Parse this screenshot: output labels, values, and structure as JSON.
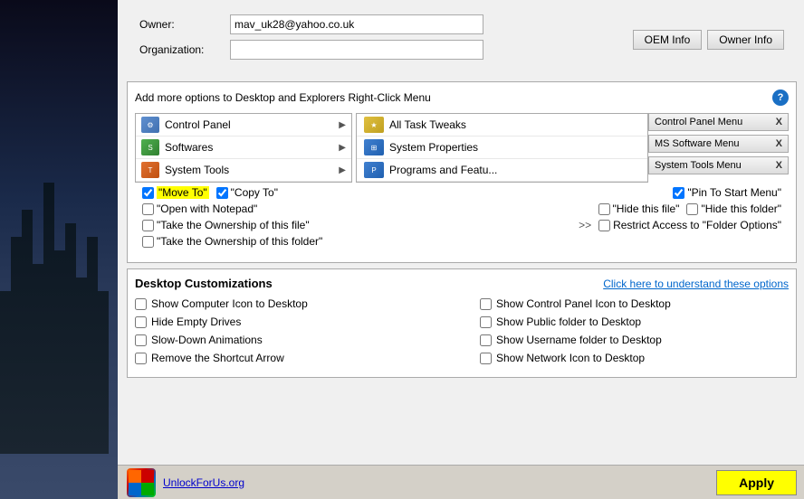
{
  "background": {
    "color": "#1a2a4a"
  },
  "panel": {
    "owner_label": "Owner:",
    "owner_value": "mav_uk28@yahoo.co.uk",
    "org_label": "Organization:",
    "org_value": "",
    "oem_button": "OEM Info",
    "owner_info_button": "Owner Info"
  },
  "rcm": {
    "title": "Add more options to Desktop and Explorers Right-Click Menu",
    "help_icon": "?",
    "tree": [
      {
        "label": "Control Panel",
        "icon": "cp"
      },
      {
        "label": "Softwares",
        "icon": "sw"
      },
      {
        "label": "System Tools",
        "icon": "st"
      }
    ],
    "tweaks": [
      {
        "label": "All Task Tweaks",
        "icon": "yellow"
      },
      {
        "label": "System Properties",
        "icon": "blue"
      },
      {
        "label": "Programs and Featu...",
        "icon": "blue"
      }
    ],
    "remove_buttons": [
      {
        "label": "Control Panel Menu",
        "x": "X"
      },
      {
        "label": "MS Software Menu",
        "x": "X"
      },
      {
        "label": "System Tools Menu",
        "x": "X"
      }
    ]
  },
  "checkboxes": {
    "row1": [
      {
        "label": "\"Move To\"",
        "checked": true,
        "highlight": true
      },
      {
        "label": "\"Copy To\"",
        "checked": true
      },
      {
        "label": "\"Pin To Start Menu\"",
        "checked": true
      }
    ],
    "row2": [
      {
        "label": "\"Open with Notepad\"",
        "checked": false
      },
      {
        "label": "\"Hide this file\"",
        "checked": false
      },
      {
        "label": "\"Hide this folder\"",
        "checked": false
      }
    ],
    "row3": [
      {
        "label": "\"Take the Ownership of this file\"",
        "checked": false
      },
      {
        "arrow": ">>",
        "label": "Restrict Access to \"Folder Options\"",
        "checked": false
      }
    ],
    "row4": [
      {
        "label": "\"Take the Ownership of this folder\"",
        "checked": false
      }
    ]
  },
  "desktop": {
    "title": "Desktop Customizations",
    "understand_link": "Click here to understand these options",
    "left_options": [
      {
        "label": "Show Computer Icon to Desktop",
        "checked": false
      },
      {
        "label": "Hide Empty Drives",
        "checked": false
      },
      {
        "label": "Slow-Down Animations",
        "checked": false
      },
      {
        "label": "Remove the Shortcut Arrow",
        "checked": false
      }
    ],
    "right_options": [
      {
        "label": "Show Control Panel Icon to Desktop",
        "checked": false
      },
      {
        "label": "Show Public folder to Desktop",
        "checked": false
      },
      {
        "label": "Show Username folder to Desktop",
        "checked": false
      },
      {
        "label": "Show Network Icon to Desktop",
        "checked": false
      }
    ]
  },
  "footer": {
    "logo_link": "UnlockForUs.org",
    "apply_button": "Apply"
  }
}
